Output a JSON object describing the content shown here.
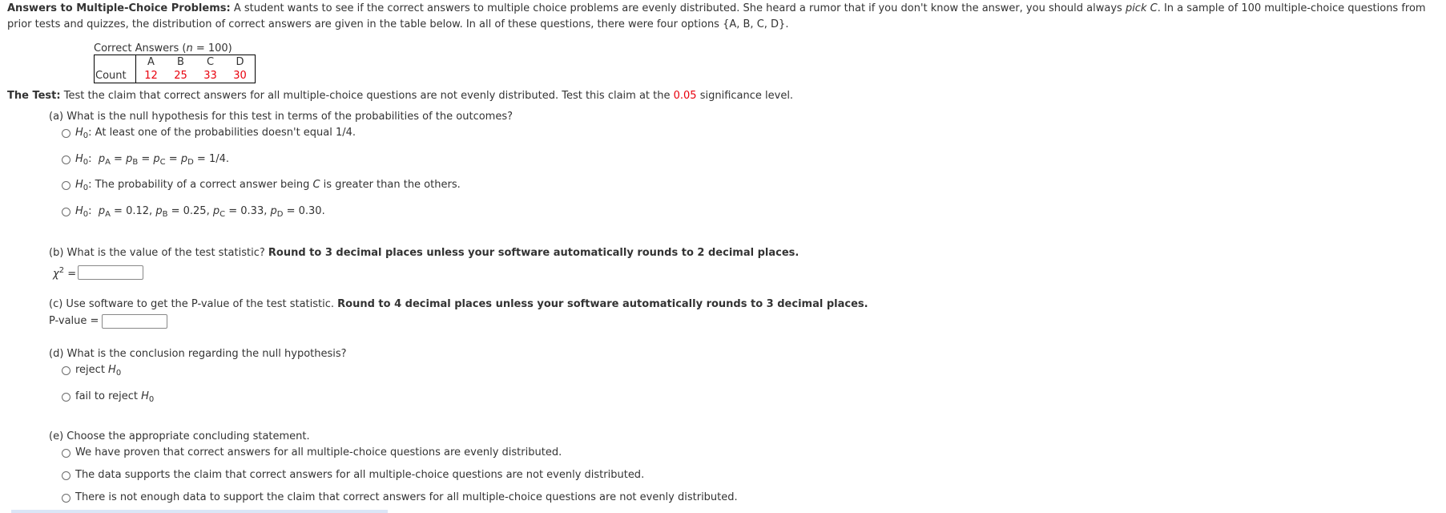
{
  "intro": {
    "title": "Answers to Multiple-Choice Problems:",
    "text_1": " A student wants to see if the correct answers to multiple choice problems are evenly distributed. She heard a rumor that if you don't know the answer, you should always ",
    "italic_phrase": "pick C",
    "text_2": ". In a sample of 100 multiple-choice questions from prior tests and quizzes, the distribution of correct answers are given in the table below. In all of these questions, there were four options {A, B, C, D}."
  },
  "table": {
    "caption_prefix": "Correct Answers (",
    "caption_var": "n",
    "caption_suffix": " = 100)",
    "row_label": "Count",
    "columns": [
      "A",
      "B",
      "C",
      "D"
    ],
    "values": [
      "12",
      "25",
      "33",
      "30"
    ]
  },
  "test": {
    "label": "The Test:",
    "text_1": " Test the claim that correct answers for all multiple-choice questions are not evenly distributed. Test this claim at the ",
    "significance": "0.05",
    "text_2": " significance level."
  },
  "part_a": {
    "question": "(a) What is the null hypothesis for this test in terms of the probabilities of the outcomes?",
    "h_label": "H",
    "h_sub": "0",
    "options": [
      ": At least one of the probabilities doesn't equal 1/4.",
      ": p_A = p_B = p_C = p_D = 1/4.",
      ": The probability of a correct answer being C is greater than the others.",
      ": p_A = 0.12, p_B = 0.25, p_C = 0.33, p_D = 0.30."
    ],
    "opt1_text": ": At least one of the probabilities doesn't equal 1/4.",
    "opt2_eq": " = 1/4.",
    "opt3_text_1": ": The probability of a correct answer being ",
    "opt3_italic": "C",
    "opt3_text_2": " is greater than the others.",
    "opt4_vals": [
      "0.12",
      "0.25",
      "0.33",
      "0.30."
    ]
  },
  "part_b": {
    "question": "(b) What is the value of the test statistic? ",
    "bold": "Round to 3 decimal places unless your software automatically rounds to 2 decimal places.",
    "label": "χ",
    "label_sup": "2",
    "eq": " = ",
    "value": ""
  },
  "part_c": {
    "question": "(c) Use software to get the P-value of the test statistic. ",
    "bold": "Round to 4 decimal places unless your software automatically rounds to 3 decimal places.",
    "label": "P-value = ",
    "value": ""
  },
  "part_d": {
    "question": "(d) What is the conclusion regarding the null hypothesis?",
    "options": [
      "reject ",
      "fail to reject "
    ],
    "h_label": "H",
    "h_sub": "0"
  },
  "part_e": {
    "question": "(e) Choose the appropriate concluding statement.",
    "options": [
      "We have proven that correct answers for all multiple-choice questions are evenly distributed.",
      "The data supports the claim that correct answers for all multiple-choice questions are not evenly distributed.",
      "There is not enough data to support the claim that correct answers for all multiple-choice questions are not evenly distributed."
    ]
  },
  "sub_labels": {
    "A": "A",
    "B": "B",
    "C": "C",
    "D": "D",
    "p": "p",
    "sep": " = ",
    "comma": ", "
  }
}
